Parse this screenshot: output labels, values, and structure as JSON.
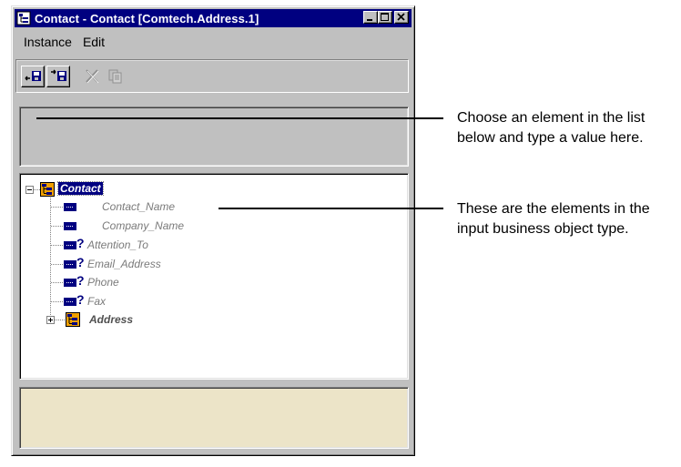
{
  "window": {
    "title": "Contact - Contact [Comtech.Address.1]",
    "app_icon": "business-object-icon",
    "controls": [
      "minimize-icon",
      "maximize-icon",
      "close-icon"
    ]
  },
  "menu": {
    "items": [
      {
        "label": "Instance"
      },
      {
        "label": "Edit"
      }
    ]
  },
  "toolbar": {
    "buttons": [
      {
        "icon": "import-icon",
        "enabled": true
      },
      {
        "icon": "export-icon",
        "enabled": true
      },
      {
        "icon": "delete-icon",
        "enabled": false
      },
      {
        "icon": "copy-icon",
        "enabled": false
      }
    ]
  },
  "value_field": {
    "value": ""
  },
  "tree": {
    "root": {
      "label": "Contact",
      "expanded": true,
      "selected": true
    },
    "children": [
      {
        "label": "Contact_Name",
        "icon": "attribute-icon",
        "required": true
      },
      {
        "label": "Company_Name",
        "icon": "attribute-icon",
        "required": true
      },
      {
        "label": "Attention_To",
        "icon": "attribute-icon",
        "required": false
      },
      {
        "label": "Email_Address",
        "icon": "attribute-icon",
        "required": false
      },
      {
        "label": "Phone",
        "icon": "attribute-icon",
        "required": false
      },
      {
        "label": "Fax",
        "icon": "attribute-icon",
        "required": false
      },
      {
        "label": "Address",
        "icon": "business-object-icon",
        "expandable": true
      }
    ],
    "unknown_marker": "?"
  },
  "description": {
    "text": ""
  },
  "callouts": [
    {
      "line1": "Choose an element in the list",
      "line2": "below and type a value here."
    },
    {
      "line1": "These are the elements in the",
      "line2": "input business object type."
    }
  ],
  "colors": {
    "title_bar": "#000080",
    "face": "#c0c0c0",
    "description_bg": "#ece4c8",
    "object_icon": "#f0a000"
  }
}
